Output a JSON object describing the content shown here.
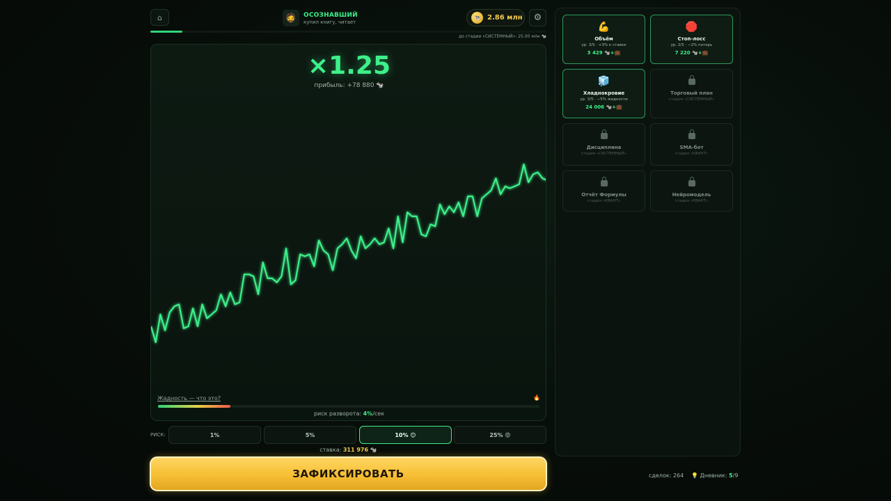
{
  "header": {
    "home_icon": "home-icon",
    "rank_avatar": "trader-avatar-icon",
    "rank_name": "ОСОЗНАВШИЙ",
    "rank_sub": "купил книгу, читает",
    "balance": "2.86 млн",
    "settings_icon": "gear-icon",
    "stage_progress_fraction": 0.08,
    "next_stage": "до стадии «СИСТЕМНЫЙ»: 25.00 млн 🐄"
  },
  "game": {
    "multiplier": "×1.25",
    "profit": "прибыль: +78 880 🐄",
    "greed_label": "Жадность — что это?",
    "greed_fraction": 0.19,
    "reversal_prefix": "риск разворота: ",
    "reversal_value": "4%",
    "reversal_suffix": "/сек",
    "line_color": "#3ef08a"
  },
  "chart_data": {
    "type": "line",
    "series": [
      {
        "values": [
          2.0,
          1.6,
          2.3,
          1.9,
          2.35,
          2.5,
          2.55,
          1.95,
          2.0,
          2.45,
          2.0,
          2.55,
          2.2,
          2.3,
          2.4,
          2.8,
          2.5,
          2.85,
          2.55,
          2.6,
          3.3,
          3.3,
          3.25,
          2.8,
          3.6,
          3.2,
          3.2,
          3.1,
          3.25,
          3.95,
          3.05,
          3.15,
          3.8,
          3.75,
          3.8,
          3.5,
          4.15,
          3.9,
          3.8,
          3.4,
          3.95,
          4.05,
          4.2,
          3.9,
          3.7,
          4.25,
          3.95,
          4.05,
          4.2,
          4.05,
          4.1,
          4.45,
          3.95,
          4.75,
          4.1,
          4.85,
          4.75,
          4.75,
          4.3,
          4.25,
          4.55,
          4.5,
          5.05,
          4.8,
          5.0,
          4.85,
          5.1,
          4.75,
          5.25,
          5.25,
          4.75,
          5.2,
          5.3,
          5.4,
          5.7,
          5.3,
          5.5,
          5.45,
          5.5,
          5.55,
          6.05,
          5.6,
          5.8,
          5.85,
          5.7,
          5.65
        ]
      }
    ],
    "ylim": [
      0,
      8
    ]
  },
  "risk": {
    "label": "РИСК:",
    "options": [
      "1%",
      "5%",
      "10% 😊",
      "25% 😡"
    ],
    "active_index": 2,
    "stake_prefix": "ставка: ",
    "stake_value": "311 976 🐄"
  },
  "fix_button": "ЗАФИКСИРОВАТЬ",
  "upgrades": [
    {
      "icon": "💪",
      "icon_name": "flexed-biceps-icon",
      "title": "Объём",
      "sub": "ур. 3/5 · +3% к ставке",
      "price": "3 429 🐄+💼",
      "owned": true
    },
    {
      "icon": "🛑",
      "icon_name": "stop-sign-icon",
      "title": "Стоп-лосс",
      "sub": "ур. 2/5 · −2% потерь",
      "price": "7 220 🐄+💼",
      "owned": true
    },
    {
      "icon": "🧊",
      "icon_name": "ice-cube-icon",
      "title": "Хладнокровие",
      "sub": "ур. 3/5 · −5% жадности",
      "price": "24 006 🐄+💼",
      "owned": true
    },
    {
      "icon_name": "lock-icon",
      "title": "Торговый план",
      "sub": "стадия «СИСТЕМНЫЙ»",
      "owned": false
    },
    {
      "icon_name": "lock-icon",
      "title": "Дисциплина",
      "sub": "стадия «СИСТЕМНЫЙ»",
      "owned": false
    },
    {
      "icon_name": "lock-icon",
      "title": "SMA-бот",
      "sub": "стадия «КВАНТ»",
      "owned": false
    },
    {
      "icon_name": "lock-icon",
      "title": "Отчёт Формулы",
      "sub": "стадия «КВАНТ»",
      "owned": false
    },
    {
      "icon_name": "lock-icon",
      "title": "Нейромодель",
      "sub": "стадия «КВАНТ»",
      "owned": false
    }
  ],
  "footer": {
    "deals": "сделок: 264",
    "diary_prefix": "💡 Дневник: ",
    "diary_count": "5",
    "diary_total": "/9"
  }
}
